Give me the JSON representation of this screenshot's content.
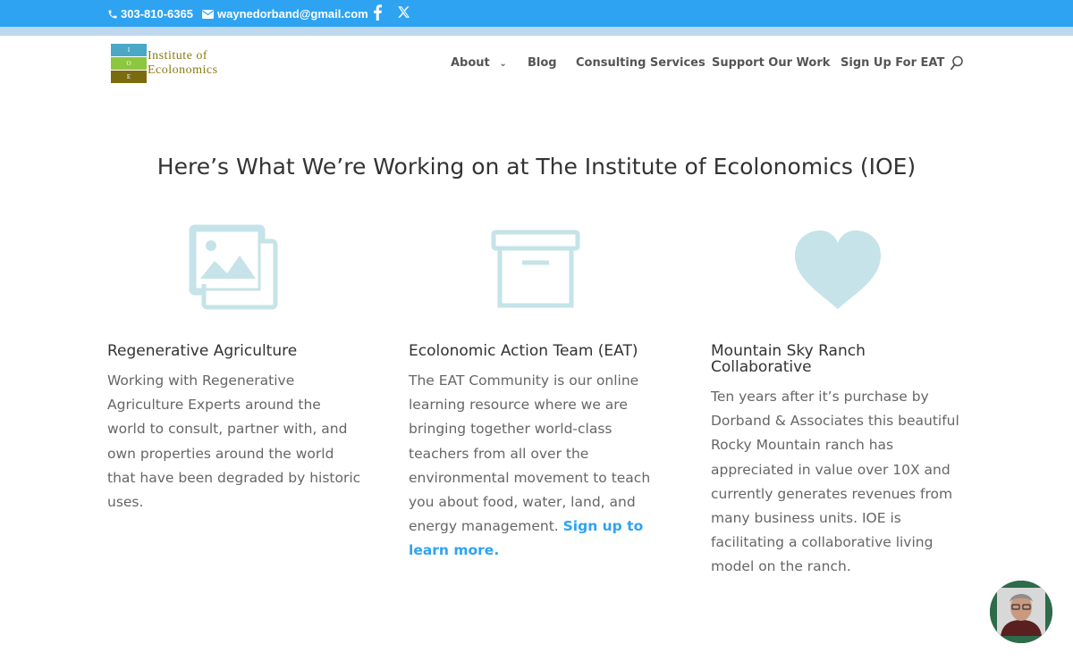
{
  "topbar": {
    "phone": "303-810-6365",
    "email": "waynedorband@gmail.com",
    "icons": [
      "phone-icon",
      "mail-icon",
      "facebook-icon",
      "x-icon"
    ],
    "color": "#2ea3f2"
  },
  "logo": {
    "block_letters": [
      "I",
      "O",
      "E"
    ],
    "line1": "Institute of",
    "line2": "Ecolonomics"
  },
  "nav": {
    "items": [
      {
        "label": "About",
        "has_dropdown": true
      },
      {
        "label": "Blog"
      },
      {
        "label": "Consulting Services"
      },
      {
        "label": "Support Our Work"
      },
      {
        "label": "Sign Up For EAT"
      }
    ]
  },
  "main": {
    "heading": "Here’s What We’re Working on at The Institute of Ecolonomics (IOE)",
    "columns": [
      {
        "icon": "images-icon",
        "title": "Regenerative Agriculture",
        "body": "Working with Regenerative Agriculture Experts around the world to consult, partner with, and own properties around the world that have been degraded by historic uses."
      },
      {
        "icon": "archive-box-icon",
        "title": "Ecolonomic Action Team (EAT)",
        "body": "The EAT Community is our online learning resource where we are bringing together world-class teachers from all over the environmental movement to teach you about food, water, land, and energy management.",
        "link": "Sign up to learn more",
        "after_link": "."
      },
      {
        "icon": "heart-icon",
        "title_line1": "Mountain Sky Ranch",
        "title_line2": "Collaborative",
        "body": "Ten years after it’s purchase by Dorband & Associates this beautiful Rocky Mountain ranch has appreciated in value over 10X and currently generates revenues from many business units.  IOE is facilitating a collaborative living model on the ranch."
      }
    ],
    "icon_color": "#c5e3e8"
  },
  "chat_widget": {
    "icon": "avatar"
  }
}
